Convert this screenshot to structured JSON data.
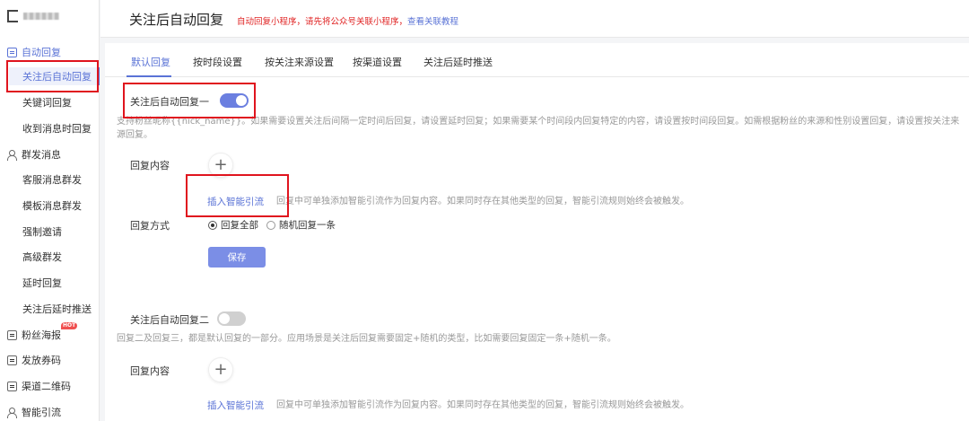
{
  "sidebar": {
    "groups": [
      {
        "label": "自动回复",
        "icon": "message-box-icon"
      },
      {
        "label": "群发消息",
        "icon": "user-group-icon"
      },
      {
        "label": "粉丝海报",
        "icon": "poster-icon",
        "badge": "HOT"
      },
      {
        "label": "发放券码",
        "icon": "coupon-icon"
      },
      {
        "label": "渠道二维码",
        "icon": "qrcode-icon"
      },
      {
        "label": "智能引流",
        "icon": "user-icon"
      }
    ],
    "auto_reply_items": [
      "关注后自动回复",
      "关键词回复",
      "收到消息时回复"
    ],
    "mass_items": [
      "客服消息群发",
      "模板消息群发",
      "强制邀请",
      "高级群发",
      "延时回复",
      "关注后延时推送"
    ]
  },
  "header": {
    "title": "关注后自动回复",
    "tip": "自动回复小程序，请先将公众号关联小程序，",
    "tip_link": "查看关联教程"
  },
  "tabs": [
    "默认回复",
    "按时段设置",
    "按关注来源设置",
    "按渠道设置",
    "关注后延时推送"
  ],
  "reply1": {
    "label": "关注后自动回复一",
    "enabled": true,
    "desc": "支持粉丝昵称{{nick_name}}。如果需要设置关注后间隔一定时间后回复，请设置延时回复；如果需要某个时间段内回复特定的内容，请设置按时间段回复。如需根据粉丝的来源和性别设置回复，请设置按关注来源回复。",
    "content_label": "回复内容",
    "insert_link": "插入智能引流",
    "insert_tip": "回复中可单独添加智能引流作为回复内容。如果同时存在其他类型的回复，智能引流规则始终会被触发。",
    "mode_label": "回复方式",
    "mode_options": [
      "回复全部",
      "随机回复一条"
    ],
    "save": "保存"
  },
  "reply2": {
    "label": "关注后自动回复二",
    "enabled": false,
    "desc": "回复二及回复三，都是默认回复的一部分。应用场景是关注后回复需要固定+随机的类型，比如需要回复固定一条+随机一条。",
    "content_label": "回复内容",
    "insert_link": "插入智能引流",
    "insert_tip": "回复中可单独添加智能引流作为回复内容。如果同时存在其他类型的回复，智能引流规则始终会被触发。"
  },
  "colors": {
    "accent": "#5a73d6",
    "highlight": "#e0141e",
    "tip": "#e02424"
  }
}
